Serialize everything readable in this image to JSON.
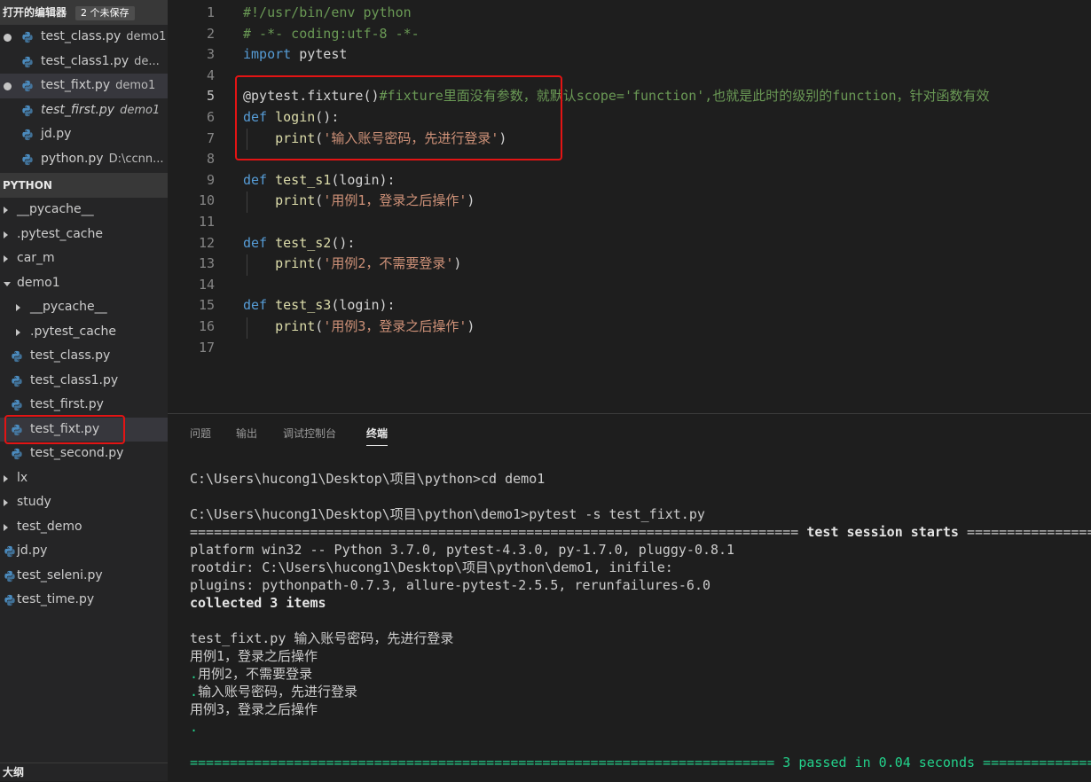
{
  "open_editors": {
    "header": "打开的编辑器",
    "badge": "2 个未保存",
    "items": [
      {
        "name": "test_class.py",
        "desc": "demo1"
      },
      {
        "name": "test_class1.py",
        "desc": "de..."
      },
      {
        "name": "test_fixt.py",
        "desc": "demo1"
      },
      {
        "name": "test_first.py",
        "desc": "demo1"
      },
      {
        "name": "jd.py",
        "desc": ""
      },
      {
        "name": "python.py",
        "desc": "D:\\ccnn..."
      }
    ]
  },
  "explorer": {
    "header": "PYTHON",
    "items": [
      {
        "name": "__pycache__"
      },
      {
        "name": ".pytest_cache"
      },
      {
        "name": "car_m"
      },
      {
        "name": "demo1"
      },
      {
        "name": "__pycache__"
      },
      {
        "name": ".pytest_cache"
      },
      {
        "name": "test_class.py"
      },
      {
        "name": "test_class1.py"
      },
      {
        "name": "test_first.py"
      },
      {
        "name": "test_fixt.py"
      },
      {
        "name": "test_second.py"
      },
      {
        "name": "lx"
      },
      {
        "name": "study"
      },
      {
        "name": "test_demo"
      },
      {
        "name": "jd.py"
      },
      {
        "name": "test_seleni.py"
      },
      {
        "name": "test_time.py"
      }
    ]
  },
  "outline": {
    "header": "大纲"
  },
  "editor": {
    "lines": [
      {
        "n": "1",
        "parts": [
          [
            "com",
            "#!/usr/bin/env python"
          ]
        ]
      },
      {
        "n": "2",
        "parts": [
          [
            "com",
            "# -*- coding:utf-8 -*-"
          ]
        ]
      },
      {
        "n": "3",
        "parts": [
          [
            "kw",
            "import"
          ],
          [
            "def",
            " pytest"
          ]
        ]
      },
      {
        "n": "4",
        "parts": []
      },
      {
        "n": "5",
        "parts": [
          [
            "def",
            "@pytest.fixture()"
          ],
          [
            "com",
            "#fixture里面没有参数，就默认scope='function',也就是此时的级别的function，针对函数有效"
          ]
        ]
      },
      {
        "n": "6",
        "parts": [
          [
            "kw",
            "def"
          ],
          [
            "def",
            " "
          ],
          [
            "fn",
            "login"
          ],
          [
            "def",
            "():"
          ]
        ]
      },
      {
        "n": "7",
        "parts": [
          [
            "def",
            "    "
          ],
          [
            "fn",
            "print"
          ],
          [
            "def",
            "("
          ],
          [
            "str",
            "'输入账号密码，先进行登录'"
          ],
          [
            "def",
            ")"
          ]
        ]
      },
      {
        "n": "8",
        "parts": []
      },
      {
        "n": "9",
        "parts": [
          [
            "kw",
            "def"
          ],
          [
            "def",
            " "
          ],
          [
            "fn",
            "test_s1"
          ],
          [
            "def",
            "(login):"
          ]
        ]
      },
      {
        "n": "10",
        "parts": [
          [
            "def",
            "    "
          ],
          [
            "fn",
            "print"
          ],
          [
            "def",
            "("
          ],
          [
            "str",
            "'用例1，登录之后操作'"
          ],
          [
            "def",
            ")"
          ]
        ]
      },
      {
        "n": "11",
        "parts": []
      },
      {
        "n": "12",
        "parts": [
          [
            "kw",
            "def"
          ],
          [
            "def",
            " "
          ],
          [
            "fn",
            "test_s2"
          ],
          [
            "def",
            "():"
          ]
        ]
      },
      {
        "n": "13",
        "parts": [
          [
            "def",
            "    "
          ],
          [
            "fn",
            "print"
          ],
          [
            "def",
            "("
          ],
          [
            "str",
            "'用例2，不需要登录'"
          ],
          [
            "def",
            ")"
          ]
        ]
      },
      {
        "n": "14",
        "parts": []
      },
      {
        "n": "15",
        "parts": [
          [
            "kw",
            "def"
          ],
          [
            "def",
            " "
          ],
          [
            "fn",
            "test_s3"
          ],
          [
            "def",
            "(login):"
          ]
        ]
      },
      {
        "n": "16",
        "parts": [
          [
            "def",
            "    "
          ],
          [
            "fn",
            "print"
          ],
          [
            "def",
            "("
          ],
          [
            "str",
            "'用例3，登录之后操作'"
          ],
          [
            "def",
            ")"
          ]
        ]
      },
      {
        "n": "17",
        "parts": []
      }
    ]
  },
  "panel": {
    "tabs": [
      "问题",
      "输出",
      "调试控制台",
      "终端"
    ],
    "active_tab": "终端"
  },
  "terminal": {
    "lines": [
      {
        "text": "C:\\Users\\hucong1\\Desktop\\项目\\python>cd demo1",
        "style": ""
      },
      {
        "text": "",
        "style": ""
      },
      {
        "text": "C:\\Users\\hucong1\\Desktop\\项目\\python\\demo1>pytest -s test_fixt.py",
        "style": ""
      },
      {
        "text": "============================================================================ test session starts ============================================================================",
        "style": "sep"
      },
      {
        "text": "platform win32 -- Python 3.7.0, pytest-4.3.0, py-1.7.0, pluggy-0.8.1",
        "style": ""
      },
      {
        "text": "rootdir: C:\\Users\\hucong1\\Desktop\\项目\\python\\demo1, inifile:",
        "style": ""
      },
      {
        "text": "plugins: pythonpath-0.7.3, allure-pytest-2.5.5, rerunfailures-6.0",
        "style": ""
      },
      {
        "text": "collected 3 items",
        "style": "bold"
      },
      {
        "text": "",
        "style": ""
      },
      {
        "text": "test_fixt.py 输入账号密码，先进行登录",
        "style": ""
      },
      {
        "text": "用例1，登录之后操作",
        "style": ""
      },
      {
        "text": ".用例2，不需要登录",
        "style": "dotlead"
      },
      {
        "text": ".输入账号密码，先进行登录",
        "style": "dotlead"
      },
      {
        "text": "用例3，登录之后操作",
        "style": ""
      },
      {
        "text": ".",
        "style": "green"
      },
      {
        "text": "",
        "style": ""
      },
      {
        "text": "========================================================================= 3 passed in 0.04 seconds =========================================================================",
        "style": "green"
      }
    ]
  },
  "colors": {
    "accent_box": "#e31414",
    "python_icon": "#4b8bbe"
  }
}
